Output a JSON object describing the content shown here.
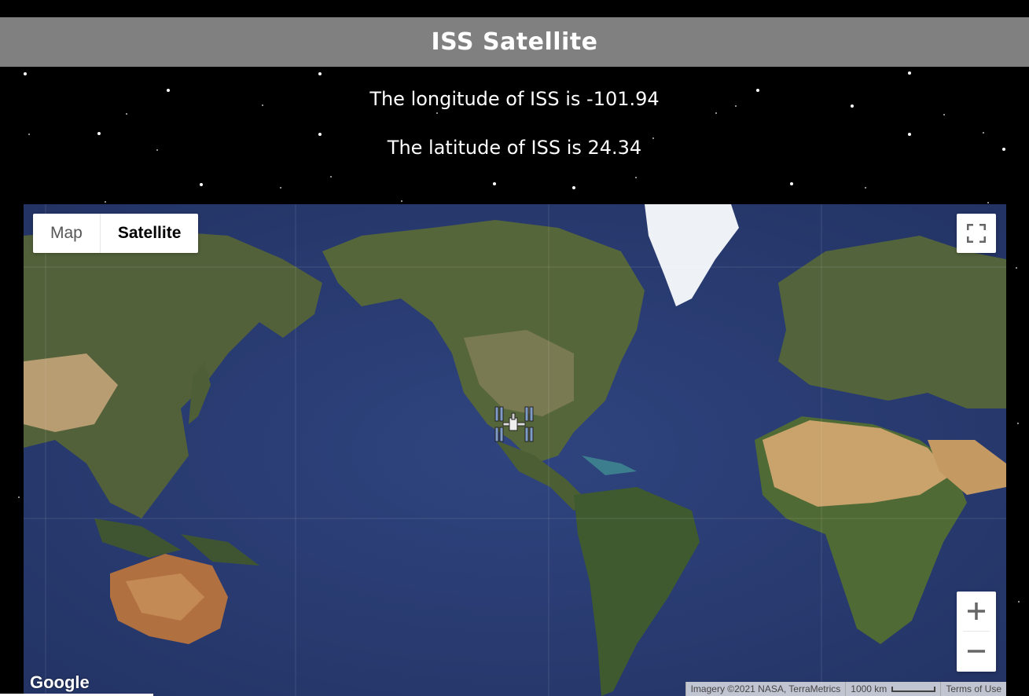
{
  "header": {
    "title": "ISS Satellite"
  },
  "info": {
    "longitude_text": "The longitude of ISS is -101.94",
    "latitude_text": "The latitude of ISS is 24.34",
    "longitude": -101.94,
    "latitude": 24.34
  },
  "map": {
    "type_buttons": {
      "map_label": "Map",
      "satellite_label": "Satellite",
      "selected": "Satellite"
    },
    "icons": {
      "fullscreen": "fullscreen-icon",
      "zoom_in": "plus-icon",
      "zoom_out": "minus-icon",
      "marker": "iss-satellite-icon"
    },
    "logo": "Google",
    "attribution": {
      "imagery": "Imagery ©2021 NASA, TerraMetrics",
      "scale": "1000 km",
      "terms": "Terms of Use"
    },
    "colors": {
      "ocean": "#2b3d78",
      "land": "#4e5e37",
      "desert": "#c9a36b",
      "ice": "#f2f4f8"
    }
  }
}
